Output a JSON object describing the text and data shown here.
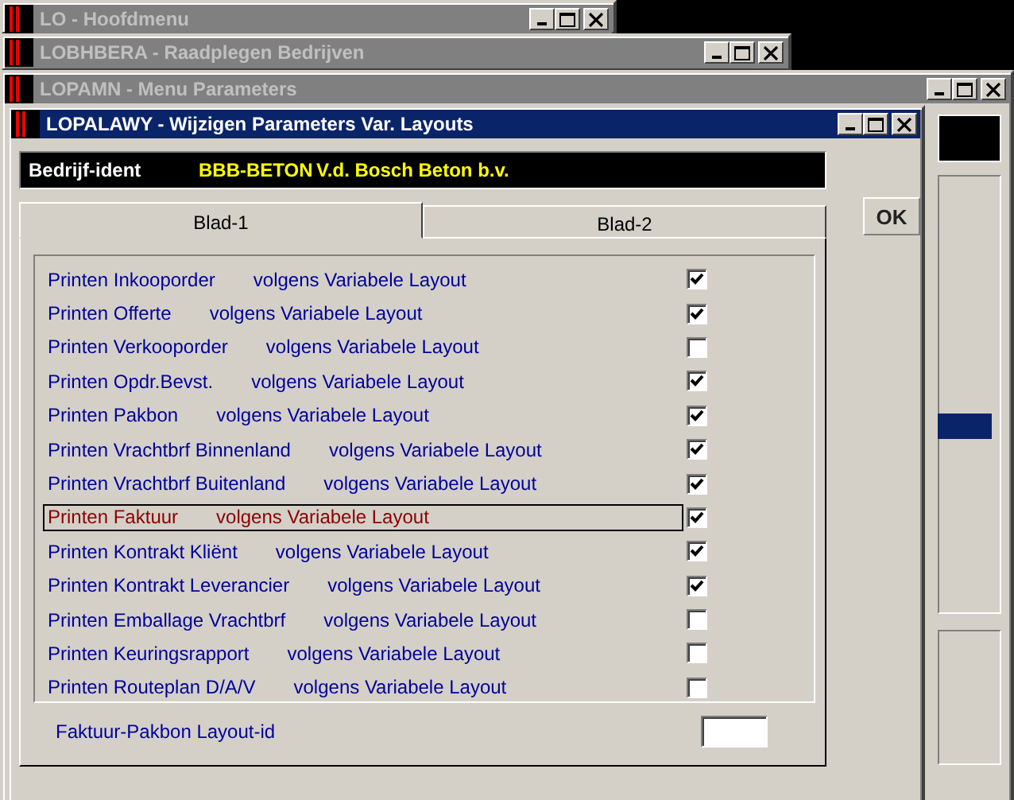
{
  "windows": [
    {
      "title": "LO - Hoofdmenu",
      "active": false
    },
    {
      "title": "LOBHBERA - Raadplegen Bedrijven",
      "active": false
    },
    {
      "title": "LOPAMN - Menu Parameters",
      "active": false
    },
    {
      "title": "LOPALAWY - Wijzigen Parameters Var. Layouts",
      "active": true
    }
  ],
  "dialog": {
    "company": {
      "label": "Bedrijf-ident",
      "code": "BBB-BETON",
      "name": "V.d. Bosch Beton b.v."
    },
    "tabs": [
      {
        "label": "Blad-1",
        "selected": true
      },
      {
        "label": "Blad-2",
        "selected": false
      }
    ],
    "rows": [
      {
        "label": "Printen Inkooporder",
        "suffix": "volgens Variabele Layout",
        "checked": true,
        "selected": false
      },
      {
        "label": "Printen Offerte",
        "suffix": "volgens Variabele Layout",
        "checked": true,
        "selected": false
      },
      {
        "label": "Printen Verkooporder",
        "suffix": "volgens Variabele Layout",
        "checked": false,
        "selected": false
      },
      {
        "label": "Printen Opdr.Bevst.",
        "suffix": "volgens Variabele Layout",
        "checked": true,
        "selected": false
      },
      {
        "label": "Printen Pakbon",
        "suffix": "volgens Variabele Layout",
        "checked": true,
        "selected": false
      },
      {
        "label": "Printen Vrachtbrf Binnenland",
        "suffix": "volgens Variabele Layout",
        "checked": true,
        "selected": false
      },
      {
        "label": "Printen Vrachtbrf Buitenland",
        "suffix": "volgens Variabele Layout",
        "checked": true,
        "selected": false
      },
      {
        "label": "Printen Faktuur",
        "suffix": "volgens Variabele Layout",
        "checked": true,
        "selected": true
      },
      {
        "label": "Printen Kontrakt Kliënt",
        "suffix": "volgens Variabele Layout",
        "checked": true,
        "selected": false
      },
      {
        "label": "Printen Kontrakt Leverancier",
        "suffix": "volgens Variabele Layout",
        "checked": true,
        "selected": false
      },
      {
        "label": "Printen Emballage Vrachtbrf",
        "suffix": "volgens Variabele Layout",
        "checked": false,
        "selected": false
      },
      {
        "label": "Printen Keuringsrapport",
        "suffix": "volgens Variabele Layout",
        "checked": false,
        "selected": false
      },
      {
        "label": "Printen Routeplan D/A/V",
        "suffix": "volgens Variabele Layout",
        "checked": false,
        "selected": false
      }
    ],
    "layout_id": {
      "label": "Faktuur-Pakbon Layout-id"
    },
    "ok_button": "OK"
  }
}
